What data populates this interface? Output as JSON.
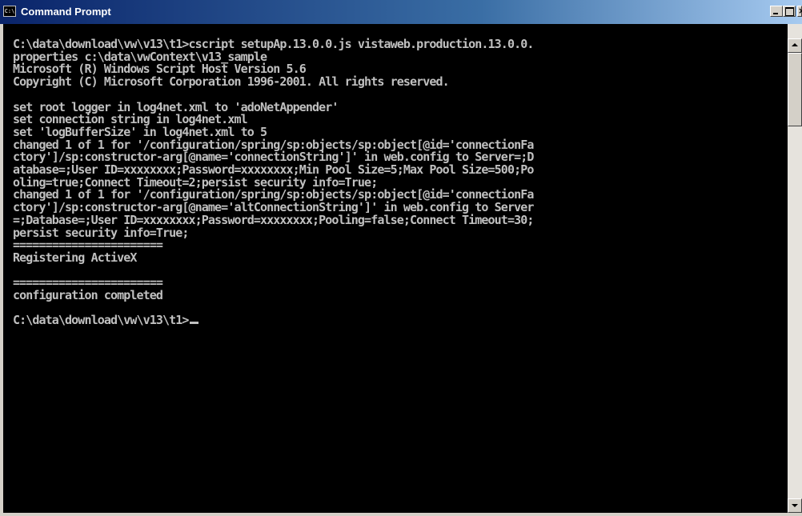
{
  "window": {
    "title": "Command Prompt",
    "icon_text": "C:\\"
  },
  "console": {
    "lines": [
      "C:\\data\\download\\vw\\v13\\t1>cscript setupAp.13.0.0.js vistaweb.production.13.0.0.",
      "properties c:\\data\\vwContext\\v13_sample",
      "Microsoft (R) Windows Script Host Version 5.6",
      "Copyright (C) Microsoft Corporation 1996-2001. All rights reserved.",
      "",
      "set root logger in log4net.xml to 'adoNetAppender'",
      "set connection string in log4net.xml",
      "set 'logBufferSize' in log4net.xml to 5",
      "changed 1 of 1 for '/configuration/spring/sp:objects/sp:object[@id='connectionFa",
      "ctory']/sp:constructor-arg[@name='connectionString']' in web.config to Server=;D",
      "atabase=;User ID=xxxxxxxx;Password=xxxxxxxx;Min Pool Size=5;Max Pool Size=500;Po",
      "oling=true;Connect Timeout=2;persist security info=True;",
      "changed 1 of 1 for '/configuration/spring/sp:objects/sp:object[@id='connectionFa",
      "ctory']/sp:constructor-arg[@name='altConnectionString']' in web.config to Server",
      "=;Database=;User ID=xxxxxxxx;Password=xxxxxxxx;Pooling=false;Connect Timeout=30;",
      "persist security info=True;",
      "=======================",
      "Registering ActiveX",
      "",
      "=======================",
      "configuration completed",
      ""
    ],
    "prompt": "C:\\data\\download\\vw\\v13\\t1>"
  }
}
